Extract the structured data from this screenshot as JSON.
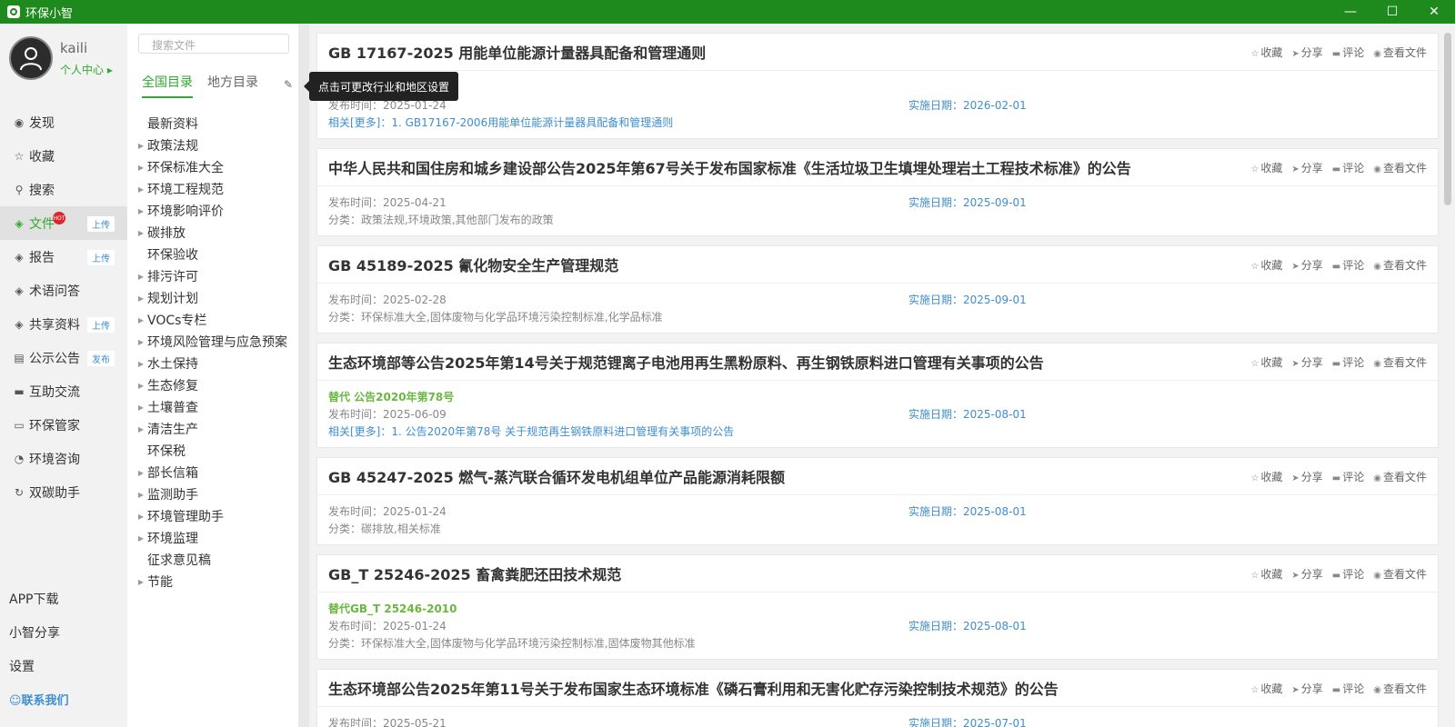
{
  "app": {
    "title": "环保小智"
  },
  "user": {
    "name": "kaili",
    "center": "个人中心 ▸"
  },
  "nav": [
    {
      "label": "发现",
      "icon": "◉",
      "badge": ""
    },
    {
      "label": "收藏",
      "icon": "☆",
      "badge": ""
    },
    {
      "label": "搜索",
      "icon": "⚲",
      "badge": ""
    },
    {
      "label": "文件",
      "icon": "◈",
      "badge": "上传",
      "hot": "HOT"
    },
    {
      "label": "报告",
      "icon": "◈",
      "badge": "上传"
    },
    {
      "label": "术语问答",
      "icon": "◈",
      "badge": ""
    },
    {
      "label": "共享资料",
      "icon": "◈",
      "badge": "上传"
    },
    {
      "label": "公示公告",
      "icon": "▤",
      "badge": "发布"
    },
    {
      "label": "互助交流",
      "icon": "▬",
      "badge": ""
    },
    {
      "label": "环保管家",
      "icon": "▭",
      "badge": ""
    },
    {
      "label": "环境咨询",
      "icon": "◔",
      "badge": ""
    },
    {
      "label": "双碳助手",
      "icon": "↻",
      "badge": ""
    }
  ],
  "bottom": {
    "app_download": "APP下载",
    "share": "小智分享",
    "settings": "设置",
    "contact": "☺联系我们"
  },
  "search": {
    "placeholder": "搜索文件"
  },
  "tabs": {
    "national": "全国目录",
    "local": "地方目录"
  },
  "tooltip": "点击可更改行业和地区设置",
  "tree": [
    {
      "label": "最新资料",
      "arrow": ""
    },
    {
      "label": "政策法规",
      "arrow": "▶"
    },
    {
      "label": "环保标准大全",
      "arrow": "▶"
    },
    {
      "label": "环境工程规范",
      "arrow": "▶"
    },
    {
      "label": "环境影响评价",
      "arrow": "▶"
    },
    {
      "label": "碳排放",
      "arrow": "▶"
    },
    {
      "label": "环保验收",
      "arrow": ""
    },
    {
      "label": "排污许可",
      "arrow": "▶"
    },
    {
      "label": "规划计划",
      "arrow": "▶"
    },
    {
      "label": "VOCs专栏",
      "arrow": "▶"
    },
    {
      "label": "环境风险管理与应急预案",
      "arrow": "▶"
    },
    {
      "label": "水土保持",
      "arrow": "▶"
    },
    {
      "label": "生态修复",
      "arrow": "▶"
    },
    {
      "label": "土壤普查",
      "arrow": "▶"
    },
    {
      "label": "清洁生产",
      "arrow": "▶"
    },
    {
      "label": "环保税",
      "arrow": ""
    },
    {
      "label": "部长信箱",
      "arrow": "▶"
    },
    {
      "label": "监测助手",
      "arrow": "▶"
    },
    {
      "label": "环境管理助手",
      "arrow": "▶"
    },
    {
      "label": "环境监理",
      "arrow": "▶"
    },
    {
      "label": "征求意见稿",
      "arrow": ""
    },
    {
      "label": "节能",
      "arrow": "▶"
    }
  ],
  "actions": {
    "favorite": "收藏",
    "share": "分享",
    "comment": "评论",
    "view": "查看文件"
  },
  "cards": [
    {
      "title": "GB 17167-2025 用能单位能源计量器具配备和管理通则",
      "replace": "",
      "publish": "发布时间：2025-01-24",
      "impl": "实施日期：2026-02-01",
      "extra": "相关[更多]：1. GB17167-2006用能单位能源计量器具配备和管理通则",
      "extra_type": "related"
    },
    {
      "title": "中华人民共和国住房和城乡建设部公告2025年第67号关于发布国家标准《生活垃圾卫生填埋处理岩土工程技术标准》的公告",
      "replace": "",
      "publish": "发布时间：2025-04-21",
      "impl": "实施日期：2025-09-01",
      "extra": "分类：政策法规,环境政策,其他部门发布的政策",
      "extra_type": "category"
    },
    {
      "title": "GB 45189-2025 氰化物安全生产管理规范",
      "replace": "",
      "publish": "发布时间：2025-02-28",
      "impl": "实施日期：2025-09-01",
      "extra": "分类：环保标准大全,固体废物与化学品环境污染控制标准,化学品标准",
      "extra_type": "category"
    },
    {
      "title": "生态环境部等公告2025年第14号关于规范锂离子电池用再生黑粉原料、再生钢铁原料进口管理有关事项的公告",
      "replace": "替代 公告2020年第78号",
      "publish": "发布时间：2025-06-09",
      "impl": "实施日期：2025-08-01",
      "extra": "相关[更多]：1. 公告2020年第78号 关于规范再生钢铁原料进口管理有关事项的公告",
      "extra_type": "related"
    },
    {
      "title": "GB 45247-2025 燃气-蒸汽联合循环发电机组单位产品能源消耗限额",
      "replace": "",
      "publish": "发布时间：2025-01-24",
      "impl": "实施日期：2025-08-01",
      "extra": "分类：碳排放,相关标准",
      "extra_type": "category"
    },
    {
      "title": "GB_T 25246-2025 畜禽粪肥还田技术规范",
      "replace": "替代GB_T 25246-2010",
      "publish": "发布时间：2025-01-24",
      "impl": "实施日期：2025-08-01",
      "extra": "分类：环保标准大全,固体废物与化学品环境污染控制标准,固体废物其他标准",
      "extra_type": "category"
    },
    {
      "title": "生态环境部公告2025年第11号关于发布国家生态环境标准《磷石膏利用和无害化贮存污染控制技术规范》的公告",
      "replace": "",
      "publish": "发布时间：2025-05-21",
      "impl": "实施日期：2025-07-01",
      "extra": "",
      "extra_type": "category"
    }
  ]
}
